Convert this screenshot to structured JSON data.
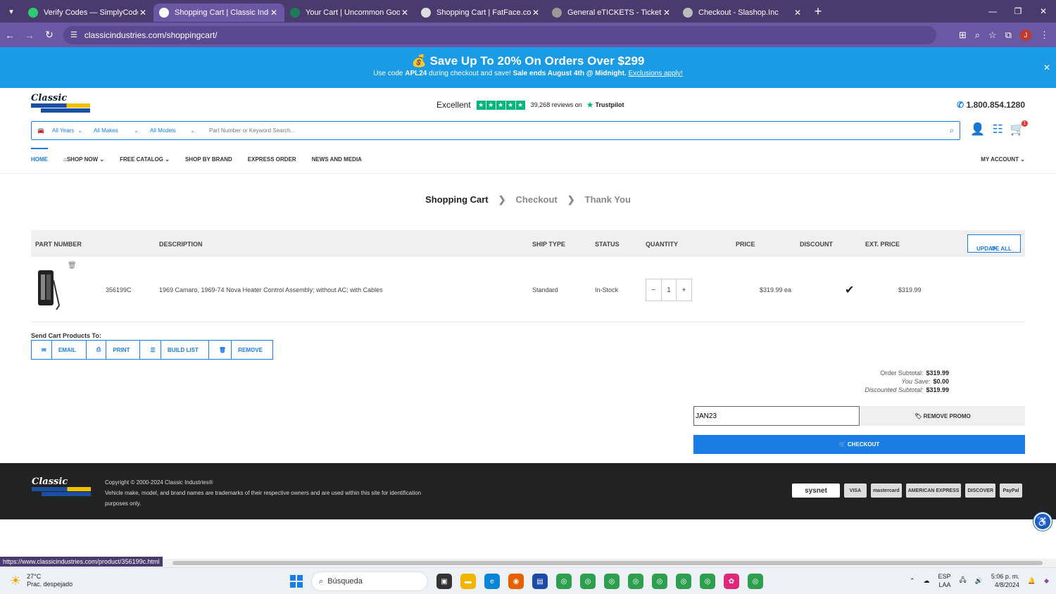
{
  "browser": {
    "tabs": [
      {
        "title": "Verify Codes — SimplyCodes",
        "color": "#2ecc71"
      },
      {
        "title": "Shopping Cart | Classic Industri",
        "color": "#ffffff"
      },
      {
        "title": "Your Cart | Uncommon Goods",
        "color": "#1e7b5a"
      },
      {
        "title": "Shopping Cart | FatFace.com",
        "color": "#dddddd"
      },
      {
        "title": "General eTICKETS - Ticketing at",
        "color": "#999999"
      },
      {
        "title": "Checkout - Slashop.Inc",
        "color": "#bbbbbb"
      }
    ],
    "url": "classicindustries.com/shoppingcart/",
    "profile_initial": "J"
  },
  "promo": {
    "headline": "Save Up To 20% On Orders Over $299",
    "sub_prefix": "Use code ",
    "code": "APL24",
    "sub_mid": " during checkout and save! ",
    "sale_ends": "Sale ends August 4th @ Midnight.",
    "link": "Exclusions apply!"
  },
  "header": {
    "logo_text": "Classic",
    "trust_excellent": "Excellent",
    "trust_reviews": "39,268 reviews on",
    "trust_brand": "Trustpilot",
    "phone": "1.800.854.1280",
    "cart_count": "1"
  },
  "search": {
    "years": "All Years",
    "makes": "All Makes",
    "models": "All Models",
    "placeholder": "Part Number or Keyword Search..."
  },
  "menu": {
    "home": "HOME",
    "shop_now": "SHOP NOW",
    "catalog": "FREE CATALOG",
    "brand": "SHOP BY BRAND",
    "express": "EXPRESS ORDER",
    "news": "NEWS AND MEDIA",
    "account": "MY ACCOUNT"
  },
  "steps": {
    "cart": "Shopping Cart",
    "checkout": "Checkout",
    "thanks": "Thank You"
  },
  "table": {
    "headers": {
      "part": "PART NUMBER",
      "desc": "DESCRIPTION",
      "ship": "SHIP TYPE",
      "status": "STATUS",
      "qty": "QUANTITY",
      "price": "PRICE",
      "discount": "DISCOUNT",
      "ext": "EXT. PRICE"
    },
    "update_all": "UPDATE ALL",
    "row": {
      "part": "356199C",
      "desc": "1969 Camaro, 1969-74 Nova Heater Control Assembly; without AC; with Cables",
      "ship": "Standard",
      "status": "In-Stock",
      "qty": "1",
      "price": "$319.99 ea",
      "ext": "$319.99"
    }
  },
  "send": {
    "label": "Send Cart Products To:",
    "email": "EMAIL",
    "print": "PRINT",
    "build": "BUILD LIST",
    "remove": "REMOVE"
  },
  "totals": {
    "order_label": "Order Subtotal:",
    "order_value": "$319.99",
    "save_label": "You Save:",
    "save_value": "$0.00",
    "disc_label": "Discounted Subtotal:",
    "disc_value": "$319.99"
  },
  "promo_code": {
    "value": "JAN23",
    "remove": "REMOVE PROMO",
    "checkout": "CHECKOUT"
  },
  "footer": {
    "copyright": "Copyright © 2000-2024 Classic Industries®",
    "notice": "Vehicle make, model, and brand names are trademarks of their respective owners and are used within this site for identification purposes only.",
    "payments": [
      "sysnet",
      "VISA",
      "mastercard",
      "AMERICAN EXPRESS",
      "DISCOVER",
      "PayPal"
    ]
  },
  "status_url": "https://www.classicindustries.com/product/356199c.html",
  "taskbar": {
    "temp": "27°C",
    "weather": "Prac. despejado",
    "search": "Búsqueda",
    "lang1": "ESP",
    "lang2": "LAA",
    "time": "5:06 p. m.",
    "date": "4/8/2024"
  }
}
